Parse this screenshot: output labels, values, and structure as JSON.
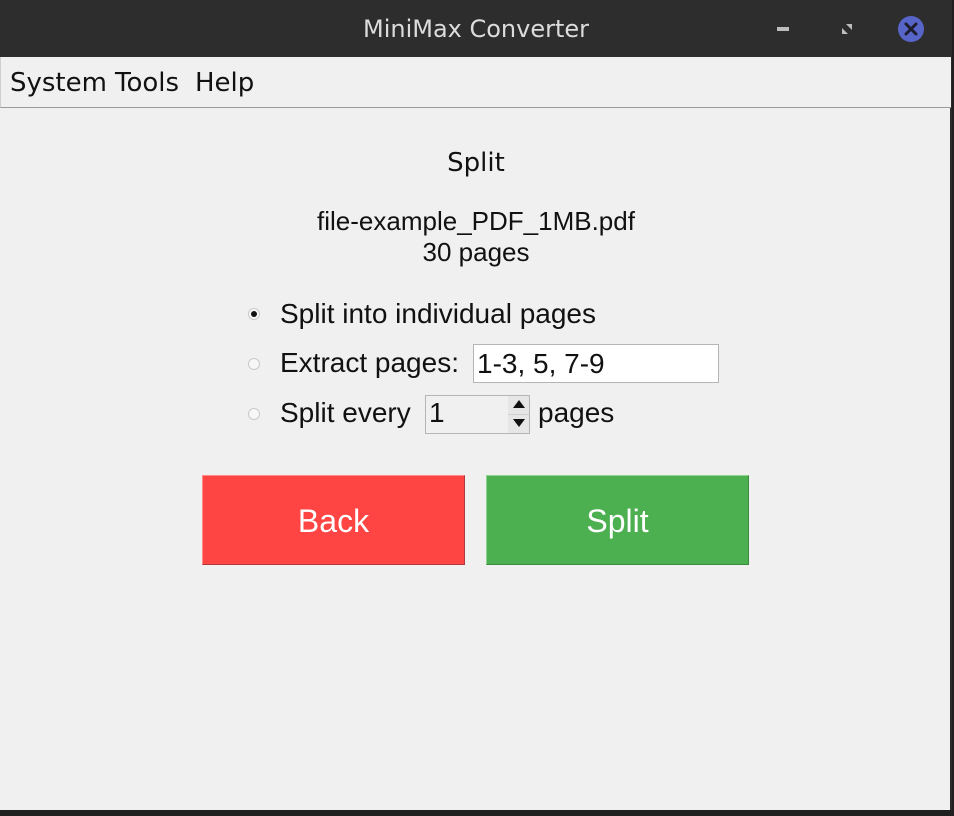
{
  "window": {
    "title": "MiniMax Converter"
  },
  "menubar": {
    "items": [
      "System",
      "Tools",
      "Help"
    ]
  },
  "page": {
    "heading": "Split",
    "filename": "file-example_PDF_1MB.pdf",
    "page_count": "30 pages"
  },
  "options": {
    "selected": "individual",
    "individual_label": "Split into individual pages",
    "extract_label": "Extract pages:",
    "extract_value": "1-3, 5, 7-9",
    "every_label": "Split every",
    "every_value": "1",
    "every_suffix": "pages"
  },
  "buttons": {
    "back_label": "Back",
    "split_label": "Split"
  },
  "colors": {
    "back": "#ff4444",
    "split": "#4caf50",
    "titlebar": "#2d2d2d",
    "close_accent": "#5865c8"
  },
  "icons": {
    "minimize": "minimize-icon",
    "maximize": "maximize-icon",
    "close": "close-icon",
    "spin_up": "triangle-up-icon",
    "spin_down": "triangle-down-icon"
  }
}
